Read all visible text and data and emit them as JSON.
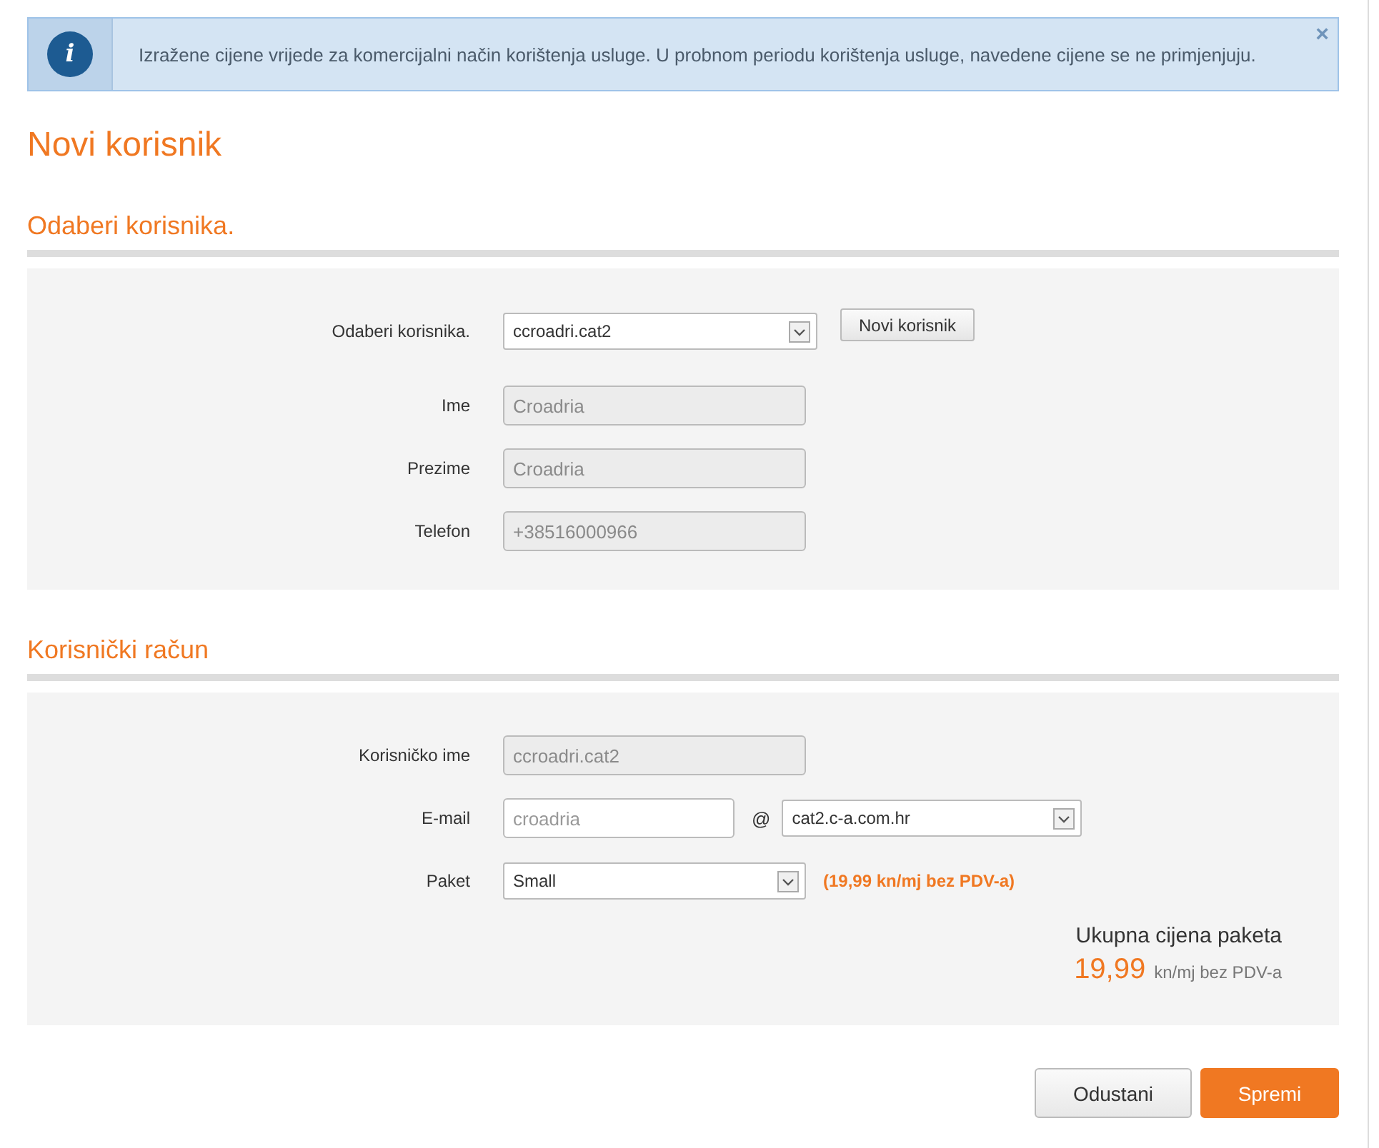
{
  "alert": {
    "icon": "i",
    "text": "Izražene cijene vrijede za komercijalni način korištenja usluge. U probnom periodu korištenja usluge, navedene cijene se ne primjenjuju.",
    "close": "×"
  },
  "title": "Novi korisnik",
  "sections": [
    {
      "heading": "Odaberi korisnika.",
      "fields": [
        {
          "kind": "select",
          "label": "Odaberi korisnika.",
          "value": "ccroadri.cat2",
          "button": "Novi korisnik"
        },
        {
          "kind": "text",
          "label": "Ime",
          "value": "Croadria",
          "disabled": true
        },
        {
          "kind": "text",
          "label": "Prezime",
          "value": "Croadria",
          "disabled": true
        },
        {
          "kind": "text",
          "label": "Telefon",
          "value": "+38516000966",
          "disabled": true
        }
      ]
    },
    {
      "heading": "Korisnički račun",
      "fields": [
        {
          "kind": "text",
          "label": "Korisničko ime",
          "value": "ccroadri.cat2",
          "disabled": true
        },
        {
          "kind": "email",
          "label": "E-mail",
          "placeholder": "croadria",
          "at": "@",
          "domain": "cat2.c-a.com.hr"
        },
        {
          "kind": "select",
          "label": "Paket",
          "value": "Small",
          "note": "(19,99 kn/mj bez PDV-a)"
        }
      ],
      "total": {
        "label": "Ukupna cijena paketa",
        "amount": "19,99",
        "unit": "kn/mj bez PDV-a"
      }
    }
  ],
  "buttons": [
    {
      "label": "Odustani",
      "kind": "secondary"
    },
    {
      "label": "Spremi",
      "kind": "primary"
    }
  ]
}
